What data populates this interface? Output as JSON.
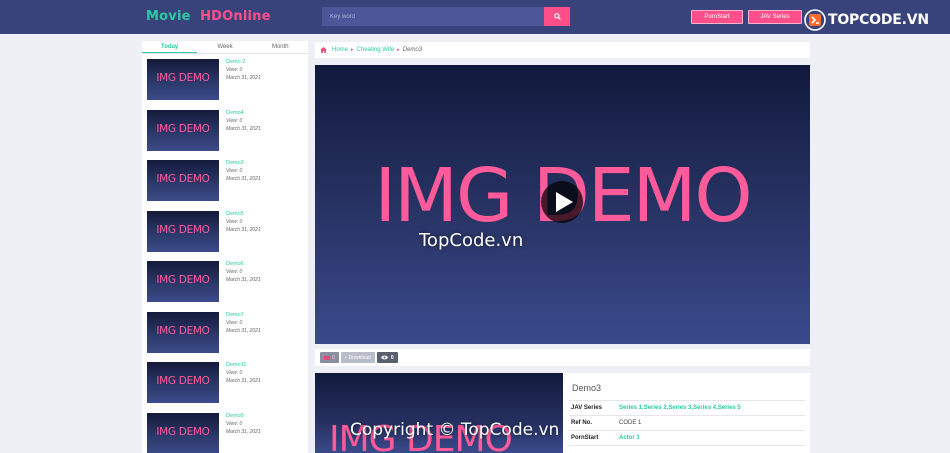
{
  "header": {
    "logo_movie": "Movie",
    "logo_hd": "HDOnline",
    "search_placeholder": "Key word",
    "porn_star_label": "PornStart",
    "jav_series_label": "JAV Series",
    "brand_name": "TOPCODE.VN"
  },
  "sidebar": {
    "tabs": [
      "Today",
      "Week",
      "Month"
    ],
    "items": [
      {
        "thumb": "IMG DEMO",
        "title": "Demo 2",
        "views": "View: 0",
        "date": "March 31, 2021"
      },
      {
        "thumb": "IMG DEMO",
        "title": "Demo4",
        "views": "View: 0",
        "date": "March 31, 2021"
      },
      {
        "thumb": "IMG DEMO",
        "title": "Demo3",
        "views": "View: 0",
        "date": "March 31, 2021"
      },
      {
        "thumb": "IMG DEMO",
        "title": "Demo5",
        "views": "View: 0",
        "date": "March 31, 2021"
      },
      {
        "thumb": "IMG DEMO",
        "title": "Demo6",
        "views": "View: 0",
        "date": "March 31, 2021"
      },
      {
        "thumb": "IMG DEMO",
        "title": "Demo7",
        "views": "View: 0",
        "date": "March 31, 2021"
      },
      {
        "thumb": "IMG DEMO",
        "title": "Demo11",
        "views": "View: 0",
        "date": "March 31, 2021"
      },
      {
        "thumb": "IMG DEMO",
        "title": "Demo9",
        "views": "View: 0",
        "date": "March 31, 2021"
      }
    ]
  },
  "breadcrumb": {
    "home": "Home",
    "category": "Cheating Wife",
    "current": "Demo3"
  },
  "player": {
    "image_text": "IMG DEMO",
    "watermark": "TopCode.vn"
  },
  "actions": {
    "flag_count": "0",
    "download_label": "Download",
    "view_count": "0"
  },
  "info": {
    "thumb_text": "IMG DEMO",
    "title": "Demo3",
    "rows": [
      {
        "label": "JAV Series",
        "value": "Series 1,Series 2,Series 3,Series 4,Series 5"
      },
      {
        "label": "Ref No.",
        "value": "CODE 1"
      },
      {
        "label": "PornStart",
        "value": "Actor 1"
      }
    ],
    "copyright": "Copyright © TopCode.vn"
  },
  "colors": {
    "header_bg": "#37437a",
    "accent_pink": "#ff4f8b",
    "accent_green": "#2bcaa3"
  }
}
